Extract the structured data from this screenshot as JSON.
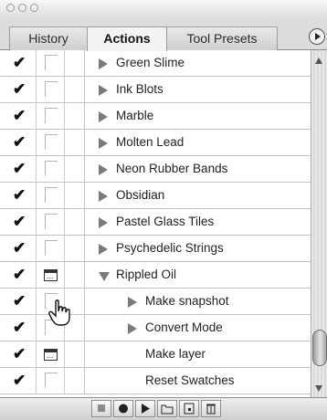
{
  "tabs": [
    {
      "label": "History",
      "active": false
    },
    {
      "label": "Actions",
      "active": true
    },
    {
      "label": "Tool Presets",
      "active": false
    }
  ],
  "actions": [
    {
      "label": "Green Slime",
      "level": 0,
      "expanded": false,
      "checked": true,
      "dialog": false
    },
    {
      "label": "Ink Blots",
      "level": 0,
      "expanded": false,
      "checked": true,
      "dialog": false
    },
    {
      "label": "Marble",
      "level": 0,
      "expanded": false,
      "checked": true,
      "dialog": false
    },
    {
      "label": "Molten Lead",
      "level": 0,
      "expanded": false,
      "checked": true,
      "dialog": false
    },
    {
      "label": "Neon Rubber Bands",
      "level": 0,
      "expanded": false,
      "checked": true,
      "dialog": false
    },
    {
      "label": "Obsidian",
      "level": 0,
      "expanded": false,
      "checked": true,
      "dialog": false
    },
    {
      "label": "Pastel Glass Tiles",
      "level": 0,
      "expanded": false,
      "checked": true,
      "dialog": false
    },
    {
      "label": "Psychedelic Strings",
      "level": 0,
      "expanded": false,
      "checked": true,
      "dialog": false
    },
    {
      "label": "Rippled Oil",
      "level": 0,
      "expanded": true,
      "checked": true,
      "dialog": true
    },
    {
      "label": "Make snapshot",
      "level": 1,
      "expanded": false,
      "checked": true,
      "dialog": false
    },
    {
      "label": "Convert Mode",
      "level": 1,
      "expanded": false,
      "checked": true,
      "dialog": false
    },
    {
      "label": "Make layer",
      "level": 1,
      "expanded": null,
      "checked": true,
      "dialog": true
    },
    {
      "label": "Reset Swatches",
      "level": 1,
      "expanded": null,
      "checked": true,
      "dialog": false
    }
  ],
  "toolbar": {
    "buttons": [
      "stop-icon",
      "record-icon",
      "play-icon",
      "folder-icon",
      "new-action-icon",
      "trash-icon"
    ]
  },
  "colors": {
    "panel": "#f3f3f3",
    "row_border": "#c4c4c4",
    "triangle": "#7a7a7a"
  }
}
